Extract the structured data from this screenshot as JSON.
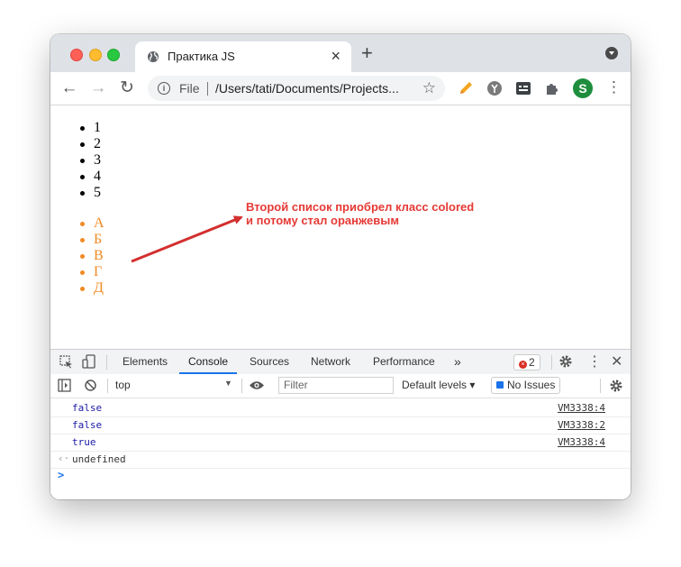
{
  "tab": {
    "title": "Практика JS"
  },
  "address": {
    "scheme_label": "File",
    "url": "/Users/tati/Documents/Projects..."
  },
  "profile": {
    "initial": "S"
  },
  "page": {
    "list1": [
      "1",
      "2",
      "3",
      "4",
      "5"
    ],
    "list2": [
      "А",
      "Б",
      "В",
      "Г",
      "Д"
    ],
    "list2_color": "#f08a24",
    "annotation_line1": "Второй список приобрел класс colored",
    "annotation_line2": "и потому стал оранжевым",
    "annotation_color": "#e53935"
  },
  "devtools": {
    "tabs": [
      "Elements",
      "Console",
      "Sources",
      "Network",
      "Performance"
    ],
    "active_tab": "Console",
    "more": "»",
    "error_count": "2",
    "context": "top",
    "filter_placeholder": "Filter",
    "levels": "Default levels ▾",
    "issues": "No Issues"
  },
  "console": {
    "logs": [
      {
        "value": "false",
        "source": "VM3338:4"
      },
      {
        "value": "false",
        "source": "VM3338:2"
      },
      {
        "value": "true",
        "source": "VM3338:4"
      }
    ],
    "return_value": "undefined",
    "prompt": ">"
  }
}
